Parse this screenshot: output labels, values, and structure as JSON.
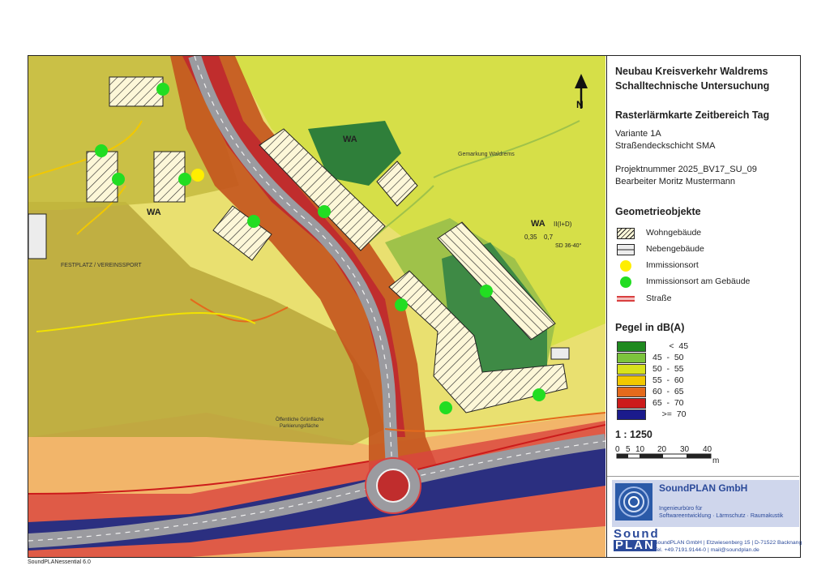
{
  "title": {
    "line1": "Neubau Kreisverkehr Waldrems",
    "line2": "Schalltechnische Untersuchung",
    "line3": "Rasterlärmkarte Zeitbereich Tag"
  },
  "info": {
    "variante": "Variante 1A",
    "deckschicht": "Straßendeckschicht SMA",
    "projekt": "Projektnummer 2025_BV17_SU_09",
    "bearbeiter": "Bearbeiter Moritz Mustermann"
  },
  "geometry_legend": {
    "heading": "Geometrieobjekte",
    "items": [
      {
        "label": "Wohngebäude",
        "symbol": "hatched-building"
      },
      {
        "label": "Nebengebäude",
        "symbol": "grey-building"
      },
      {
        "label": "Immissionsort",
        "symbol": "yellow-dot",
        "color": "#ffee00"
      },
      {
        "label": "Immissionsort am Gebäude",
        "symbol": "green-dot",
        "color": "#22dd22"
      },
      {
        "label": "Straße",
        "symbol": "road-line",
        "color": "#d94040"
      }
    ]
  },
  "level_legend": {
    "heading": "Pegel in dB(A)",
    "classes": [
      {
        "label": "       <  45",
        "color": "#1f8a1f"
      },
      {
        "label": "45  -  50",
        "color": "#7cc43c"
      },
      {
        "label": "50  -  55",
        "color": "#d8e21c"
      },
      {
        "label": "55  -  60",
        "color": "#f2c800"
      },
      {
        "label": "60  -  65",
        "color": "#e46a1c"
      },
      {
        "label": "65  -  70",
        "color": "#cc1b1b"
      },
      {
        "label": "    >=  70",
        "color": "#1b1b8c"
      }
    ]
  },
  "scale": {
    "ratio": "1 : 1250",
    "ticks": [
      "0",
      "5",
      "10",
      "20",
      "30",
      "40"
    ],
    "unit": "m"
  },
  "company": {
    "name": "SoundPLAN GmbH",
    "tag1": "Ingenieurbüro für",
    "tag2": "Softwareentwicklung  ·  Lärmschutz  ·  Raumakustik",
    "addr1": "SoundPLAN GmbH   |  Etzwiesenberg 15  |  D-71522 Backnang",
    "addr2": "Tel. +49.7191.9144-0  |  mail@soundplan.de",
    "brand1": "Sound",
    "brand2": "PLAN"
  },
  "map_text": {
    "north": "N",
    "gemarkung": "Gemarkung Waldrems",
    "festplatz": "FESTPLATZ / VEREINSSPORT",
    "wa1": "WA",
    "wa_codes": [
      "0,35",
      "0,7",
      "SD 36-40°",
      "II(I+D)"
    ],
    "oeff": "Öffentliche Grünfläche",
    "park": "Parkierungsfläche"
  },
  "footer": "SoundPLANessential 6.0"
}
